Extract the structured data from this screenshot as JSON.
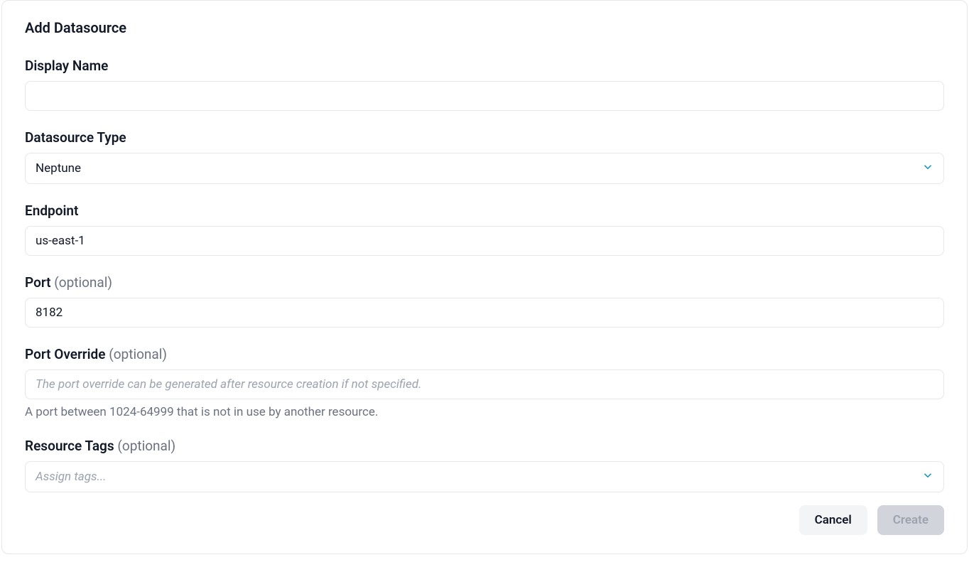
{
  "title": "Add Datasource",
  "optionalSuffix": "(optional)",
  "fields": {
    "displayName": {
      "label": "Display Name",
      "value": ""
    },
    "datasourceType": {
      "label": "Datasource Type",
      "value": "Neptune"
    },
    "endpoint": {
      "label": "Endpoint",
      "value": "us-east-1"
    },
    "port": {
      "label": "Port",
      "value": "8182"
    },
    "portOverride": {
      "label": "Port Override",
      "placeholder": "The port override can be generated after resource creation if not specified.",
      "help": "A port between 1024-64999 that is not in use by another resource."
    },
    "resourceTags": {
      "label": "Resource Tags",
      "placeholder": "Assign tags..."
    }
  },
  "buttons": {
    "cancel": "Cancel",
    "create": "Create"
  }
}
